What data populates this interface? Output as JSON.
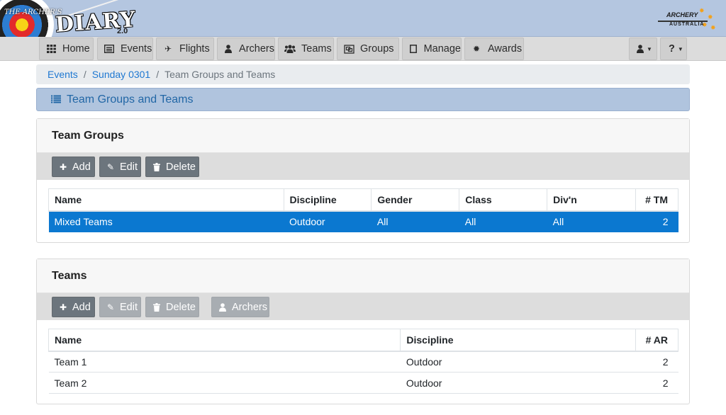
{
  "header": {
    "logo_small": "THE ARCHER'S",
    "logo_big": "DIARY",
    "logo_version": "2.0",
    "partner_logo_top": "ARCHERY",
    "partner_logo_bottom": "AUSTRALIA"
  },
  "nav": {
    "items": [
      {
        "label": "Home",
        "icon": "grid-icon"
      },
      {
        "label": "Events",
        "icon": "list-box-icon"
      },
      {
        "label": "Flights",
        "icon": "plane-icon"
      },
      {
        "label": "Archers",
        "icon": "user-icon"
      },
      {
        "label": "Teams",
        "icon": "users-icon"
      },
      {
        "label": "Groups",
        "icon": "object-group-icon"
      },
      {
        "label": "Manage",
        "icon": "square-icon"
      },
      {
        "label": "Awards",
        "icon": "certificate-icon"
      }
    ],
    "user_menu_icon": "user-icon",
    "help_menu_label": "?"
  },
  "breadcrumb": {
    "items": [
      "Events",
      "Sunday 0301"
    ],
    "active": "Team Groups and Teams"
  },
  "page_title": "Team Groups and Teams",
  "team_groups": {
    "heading": "Team Groups",
    "buttons": {
      "add": "Add",
      "edit": "Edit",
      "delete": "Delete"
    },
    "columns": [
      "Name",
      "Discipline",
      "Gender",
      "Class",
      "Div'n",
      "# TM"
    ],
    "rows": [
      {
        "name": "Mixed Teams",
        "discipline": "Outdoor",
        "gender": "All",
        "class": "All",
        "division": "All",
        "tm": "2",
        "selected": true
      }
    ]
  },
  "teams": {
    "heading": "Teams",
    "buttons": {
      "add": "Add",
      "edit": "Edit",
      "delete": "Delete",
      "archers": "Archers"
    },
    "columns": [
      "Name",
      "Discipline",
      "# AR"
    ],
    "rows": [
      {
        "name": "Team 1",
        "discipline": "Outdoor",
        "ar": "2"
      },
      {
        "name": "Team 2",
        "discipline": "Outdoor",
        "ar": "2"
      }
    ]
  },
  "colors": {
    "header_bg": "#b4c6e0",
    "title_bar_bg": "#b0c4de",
    "link": "#1f78d1",
    "selected_row": "#0b78d0",
    "button_dark": "#6c757d",
    "button_disabled": "#a8adb2"
  }
}
